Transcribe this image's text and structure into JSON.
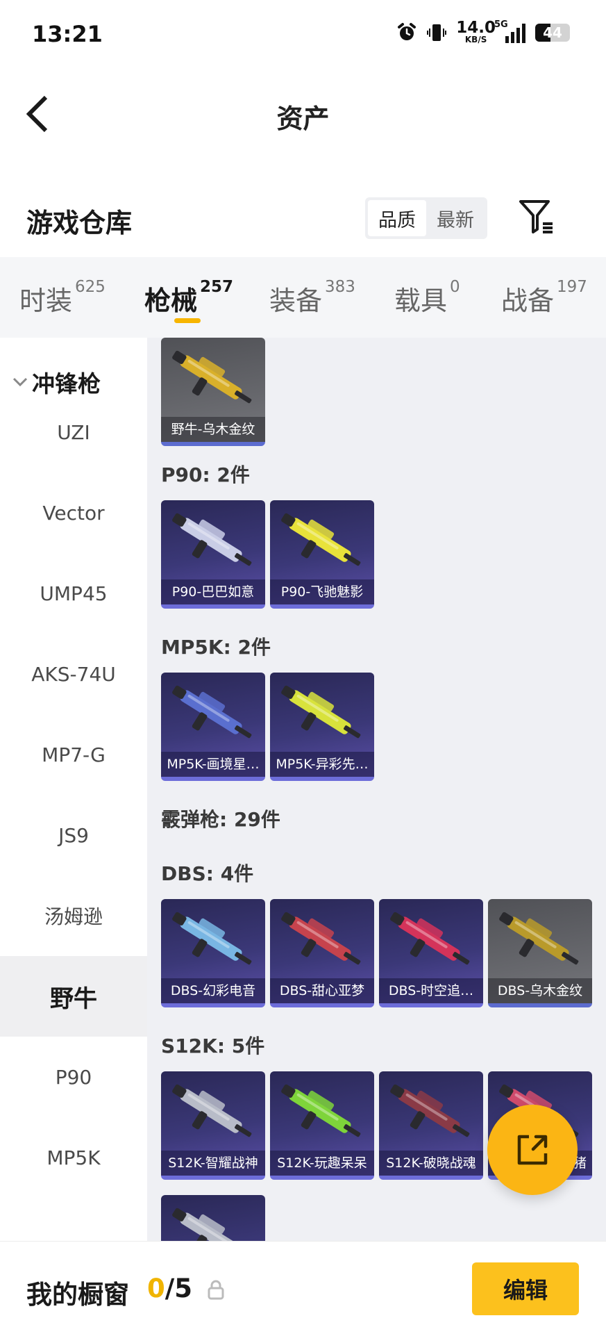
{
  "status_bar": {
    "time": "13:21",
    "net_speed_value": "14.0",
    "net_speed_unit": "KB/S",
    "signal_label": "5G",
    "battery_level": "44",
    "battery_fraction": 0.44,
    "icons": [
      "alarm-icon",
      "vibrate-icon",
      "signal-icon",
      "battery-icon"
    ]
  },
  "header": {
    "title": "资产",
    "back_icon": "chevron-left-icon"
  },
  "warehouse": {
    "title": "游戏仓库",
    "sort_options": [
      "品质",
      "最新"
    ],
    "sort_selected": "品质",
    "filter_icon": "filter-icon"
  },
  "tabs": [
    {
      "label": "时装",
      "count": "625"
    },
    {
      "label": "枪械",
      "count": "257"
    },
    {
      "label": "装备",
      "count": "383"
    },
    {
      "label": "载具",
      "count": "0"
    },
    {
      "label": "战备",
      "count": "197"
    }
  ],
  "active_tab": "枪械",
  "sidebar": {
    "category": "冲锋枪",
    "items": [
      "UZI",
      "Vector",
      "UMP45",
      "AKS-74U",
      "MP7-G",
      "JS9",
      "汤姆逊",
      "野牛",
      "P90",
      "MP5K"
    ],
    "active_item": "野牛"
  },
  "content": {
    "top_cards": [
      {
        "name": "野牛-乌木金纹",
        "rarity": "gray",
        "color": "#d9b02a"
      }
    ],
    "groups": [
      {
        "label": "P90: 2件",
        "cards": [
          {
            "name": "P90-巴巴如意",
            "color": "#c9cde6"
          },
          {
            "name": "P90-飞驰魅影",
            "color": "#e8e23a"
          }
        ]
      },
      {
        "label": "MP5K: 2件",
        "cards": [
          {
            "name": "MP5K-画境星…",
            "color": "#5a6fcf"
          },
          {
            "name": "MP5K-异彩先…",
            "color": "#d8e23c"
          }
        ]
      }
    ],
    "shotgun_label": "霰弹枪: 29件",
    "groups2": [
      {
        "label": "DBS: 4件",
        "cards": [
          {
            "name": "DBS-幻彩电音",
            "color": "#79b6e3"
          },
          {
            "name": "DBS-甜心亚梦",
            "color": "#c6434d"
          },
          {
            "name": "DBS-时空追…",
            "color": "#d4335a"
          },
          {
            "name": "DBS-乌木金纹",
            "color": "#b99a2a",
            "rarity": "gray"
          }
        ]
      },
      {
        "label": "S12K: 5件",
        "cards": [
          {
            "name": "S12K-智耀战神",
            "color": "#b8bcc8"
          },
          {
            "name": "S12K-玩趣呆呆",
            "color": "#7ed43a"
          },
          {
            "name": "S12K-破晓战魂",
            "color": "#8a3a46"
          },
          {
            "name": "猪",
            "color": "#d04b6c"
          }
        ]
      }
    ]
  },
  "fab": {
    "icon": "share-external-icon"
  },
  "bottom_bar": {
    "label": "我的橱窗",
    "current": "0",
    "separator": "/",
    "total": "5",
    "lock_icon": "lock-icon",
    "edit_label": "编辑"
  }
}
